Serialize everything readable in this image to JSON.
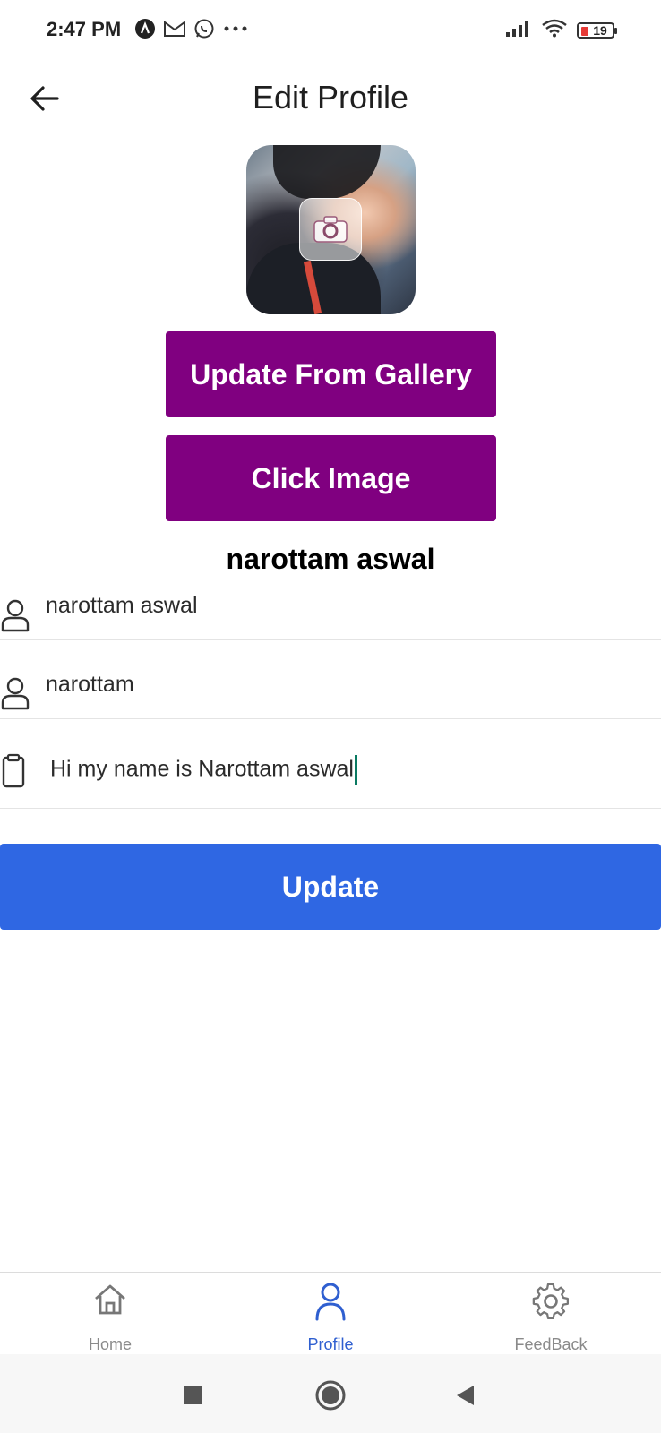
{
  "status_bar": {
    "time": "2:47 PM",
    "battery_level": "19",
    "notification_icons": [
      "assistant-icon",
      "gmail-icon",
      "whatsapp-icon",
      "more-dots-icon"
    ],
    "system_icons": [
      "signal-icon",
      "wifi-icon",
      "battery-icon"
    ]
  },
  "header": {
    "title": "Edit Profile",
    "back_icon": "arrow-left-icon"
  },
  "profile": {
    "display_name": "narottam aswal",
    "avatar_overlay_icon": "camera-icon"
  },
  "buttons": {
    "gallery_label": "Update From Gallery",
    "camera_label": "Click Image",
    "update_label": "Update"
  },
  "fields": {
    "full_name": {
      "value": "narottam aswal",
      "icon": "user-icon"
    },
    "username": {
      "value": "narottam",
      "icon": "user-icon"
    },
    "bio": {
      "value": "Hi my name is Narottam aswal",
      "icon": "clipboard-icon"
    }
  },
  "bottom_nav": {
    "items": [
      {
        "label": "Home",
        "icon": "home-icon",
        "active": false
      },
      {
        "label": "Profile",
        "icon": "profile-icon",
        "active": true
      },
      {
        "label": "FeedBack",
        "icon": "gear-icon",
        "active": false
      }
    ]
  },
  "colors": {
    "purple_button": "#800080",
    "update_button": "#2f67e3",
    "active_nav": "#2f5fd0",
    "cursor": "#0a7a62"
  }
}
